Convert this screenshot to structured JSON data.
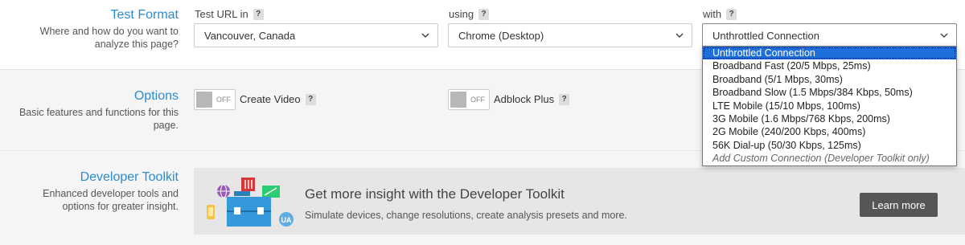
{
  "test_format": {
    "title": "Test Format",
    "description": "Where and how do you want to analyze this page?",
    "location_label": "Test URL in",
    "location_value": "Vancouver, Canada",
    "browser_label": "using",
    "browser_value": "Chrome (Desktop)",
    "connection_label": "with",
    "connection_value": "Unthrottled Connection",
    "help_glyph": "?"
  },
  "connection_dropdown": {
    "options": [
      "Unthrottled Connection",
      "Broadband Fast (20/5 Mbps, 25ms)",
      "Broadband (5/1 Mbps, 30ms)",
      "Broadband Slow (1.5 Mbps/384 Kbps, 50ms)",
      "LTE Mobile (15/10 Mbps, 100ms)",
      "3G Mobile (1.6 Mbps/768 Kbps, 200ms)",
      "2G Mobile (240/200 Kbps, 400ms)",
      "56K Dial-up (50/30 Kbps, 125ms)",
      "Add Custom Connection (Developer Toolkit only)"
    ],
    "selected_index": 0
  },
  "options": {
    "title": "Options",
    "description": "Basic features and functions for this page.",
    "video_toggle_state": "OFF",
    "video_label": "Create Video",
    "adblock_toggle_state": "OFF",
    "adblock_label": "Adblock Plus"
  },
  "developer_toolkit": {
    "title": "Developer Toolkit",
    "description": "Enhanced developer tools and options for greater insight.",
    "promo_title": "Get more insight with the Developer Toolkit",
    "promo_subtitle": "Simulate devices, change resolutions, create analysis presets and more.",
    "learn_more_label": "Learn more",
    "ua_badge": "UA"
  },
  "colors": {
    "accent_blue": "#2a8bd1",
    "selected_option": "#1e6fd9",
    "button_dark": "#565656"
  }
}
